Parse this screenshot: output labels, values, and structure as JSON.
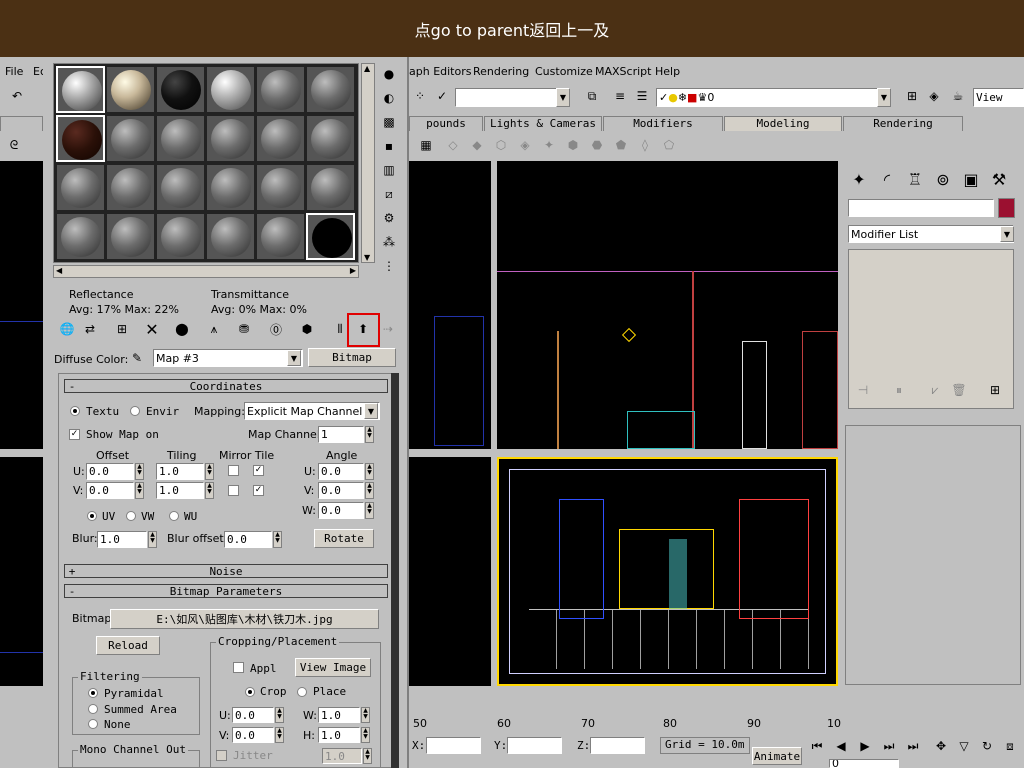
{
  "banner": {
    "text": "点go to parent返回上一及"
  },
  "menubar": {
    "file": "File",
    "edit_partial": "Ec",
    "graph_editors": "aph Editors",
    "rendering": "Rendering",
    "customize": "Customize",
    "maxscript": "MAXScript",
    "help": "Help"
  },
  "toolbar": {
    "selection_set": "",
    "layer_value": "0",
    "view_label": "View"
  },
  "tabs": {
    "compounds": "pounds",
    "lights_cameras": "Lights & Cameras",
    "modifiers": "Modifiers",
    "modeling": "Modeling",
    "rendering": "Rendering"
  },
  "command_panel": {
    "name_field": "",
    "color_swatch": "#9b1030",
    "modifier_list": "Modifier List"
  },
  "status_bar": {
    "x_label": "X:",
    "y_label": "Y:",
    "z_label": "Z:",
    "grid": "Grid = 10.0m",
    "animate": "Animate",
    "frame": "0",
    "ticks": [
      "50",
      "60",
      "70",
      "80",
      "90",
      "10"
    ]
  },
  "mat_editor": {
    "reflectance_label": "Reflectance",
    "reflectance_values": "Avg:  17% Max:  22%",
    "transmittance_label": "Transmittance",
    "transmittance_values": "Avg:    0% Max:     0%",
    "diffuse_label": "Diffuse Color:",
    "map_name": "Map #3",
    "map_type": "Bitmap",
    "coordinates": {
      "title": "Coordinates",
      "texture": "Textu",
      "environ": "Envir",
      "mapping_label": "Mapping:",
      "mapping_value": "Explicit Map Channel",
      "show_map": "Show Map on",
      "map_channel_label": "Map Channel:",
      "map_channel_value": "1",
      "offset": "Offset",
      "tiling": "Tiling",
      "mirror_tile": "Mirror Tile",
      "angle": "Angle",
      "u_label": "U:",
      "v_label": "V:",
      "w_label": "W:",
      "u_offset": "0.0",
      "v_offset": "0.0",
      "u_tiling": "1.0",
      "v_tiling": "1.0",
      "u_angle": "0.0",
      "v_angle": "0.0",
      "w_angle": "0.0",
      "uv": "UV",
      "vw": "VW",
      "wu": "WU",
      "blur_label": "Blur:",
      "blur_value": "1.0",
      "blur_offset_label": "Blur offset:",
      "blur_offset_value": "0.0",
      "rotate": "Rotate"
    },
    "noise": {
      "title": "Noise"
    },
    "bitmap_params": {
      "title": "Bitmap Parameters",
      "bitmap_label": "Bitmap:",
      "bitmap_path": "E:\\如风\\贴图库\\木材\\铁刀木.jpg",
      "reload": "Reload",
      "cropping": "Cropping/Placement",
      "apply": "Appl",
      "view_image": "View Image",
      "crop": "Crop",
      "place": "Place",
      "u_label": "U:",
      "v_label": "V:",
      "w_label": "W:",
      "h_label": "H:",
      "u_val": "0.0",
      "v_val": "0.0",
      "w_val": "1.0",
      "h_val": "1.0",
      "jitter": "Jitter",
      "jitter_val": "1.0",
      "filtering": "Filtering",
      "pyramidal": "Pyramidal",
      "summed_area": "Summed Area",
      "none": "None",
      "mono_channel": "Mono Channel Out"
    }
  }
}
